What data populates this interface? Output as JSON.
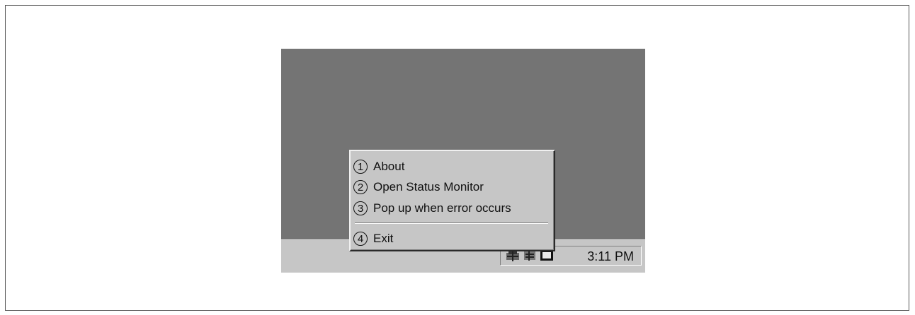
{
  "menu": {
    "items": [
      {
        "number": "1",
        "label": "About"
      },
      {
        "number": "2",
        "label": "Open Status Monitor"
      },
      {
        "number": "3",
        "label": "Pop up when error occurs"
      },
      {
        "number": "4",
        "label": "Exit"
      }
    ]
  },
  "taskbar": {
    "clock": "3:11 PM",
    "tray_icons": [
      "network-icon",
      "printer-status-icon",
      "monitor-icon"
    ]
  }
}
